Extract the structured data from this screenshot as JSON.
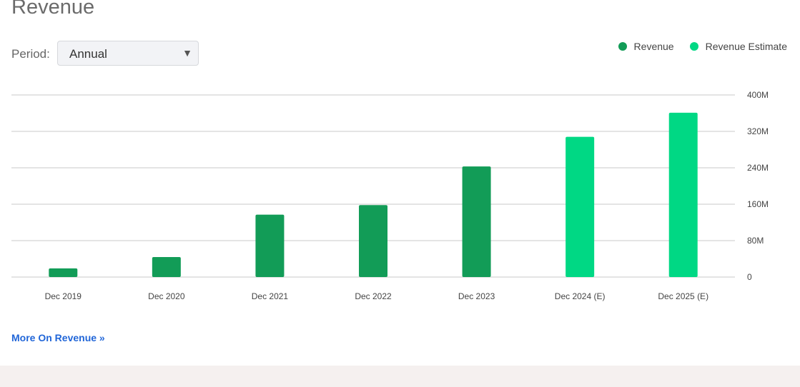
{
  "title": "Revenue",
  "period": {
    "label": "Period:",
    "value": "Annual",
    "chevron": "▼"
  },
  "more_link": "More On Revenue »",
  "chart_data": {
    "type": "bar",
    "categories": [
      "Dec 2019",
      "Dec 2020",
      "Dec 2021",
      "Dec 2022",
      "Dec 2023",
      "Dec 2024 (E)",
      "Dec 2025 (E)"
    ],
    "series": [
      {
        "name": "Revenue",
        "color": "#129c57",
        "values": [
          19,
          44,
          137,
          158,
          243,
          null,
          null
        ]
      },
      {
        "name": "Revenue Estimate",
        "color": "#00d884",
        "values": [
          null,
          null,
          null,
          null,
          null,
          308,
          361
        ]
      }
    ],
    "unit": "M",
    "ylim": [
      0,
      400
    ],
    "yticks": [
      0,
      80,
      160,
      240,
      320,
      400
    ],
    "ytick_labels": [
      "0",
      "80M",
      "160M",
      "240M",
      "320M",
      "400M"
    ],
    "grid": true,
    "legend": "top-right"
  }
}
